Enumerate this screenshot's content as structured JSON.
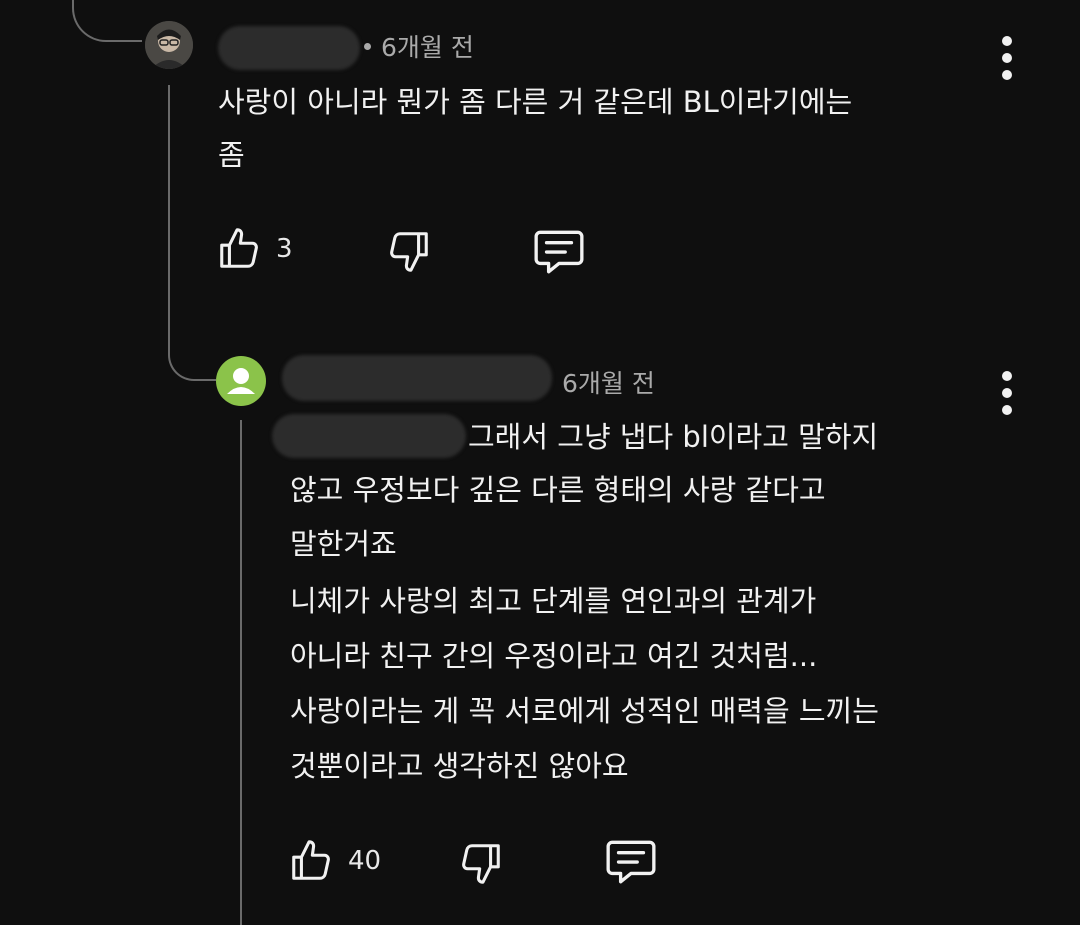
{
  "comment1": {
    "time": "6개월 전",
    "text_line1": "사랑이 아니라 뭔가 좀 다른 거 같은데 BL이라기에는",
    "text_line2": "좀",
    "likes": "3"
  },
  "comment2": {
    "time": "6개월 전",
    "line1": "그래서 그냥 냅다 bl이라고 말하지",
    "line2": "않고 우정보다 깊은 다른 형태의 사랑 같다고",
    "line3": "말한거죠",
    "line4": "니체가 사랑의 최고 단계를 연인과의 관계가",
    "line5": "아니라 친구 간의 우정이라고 여긴 것처럼...",
    "line6": "사랑이라는 게 꼭 서로에게 성적인 매력을 느끼는",
    "line7": "것뿐이라고 생각하진 않아요",
    "likes": "40"
  },
  "icons": {
    "like": "thumbs-up-icon",
    "dislike": "thumbs-down-icon",
    "reply": "reply-icon",
    "menu": "more-vert-icon"
  },
  "colors": {
    "background": "#0f0f0f",
    "text": "#f1f1f1",
    "secondary_text": "#aaaaaa",
    "avatar_green": "#8bc34a"
  }
}
